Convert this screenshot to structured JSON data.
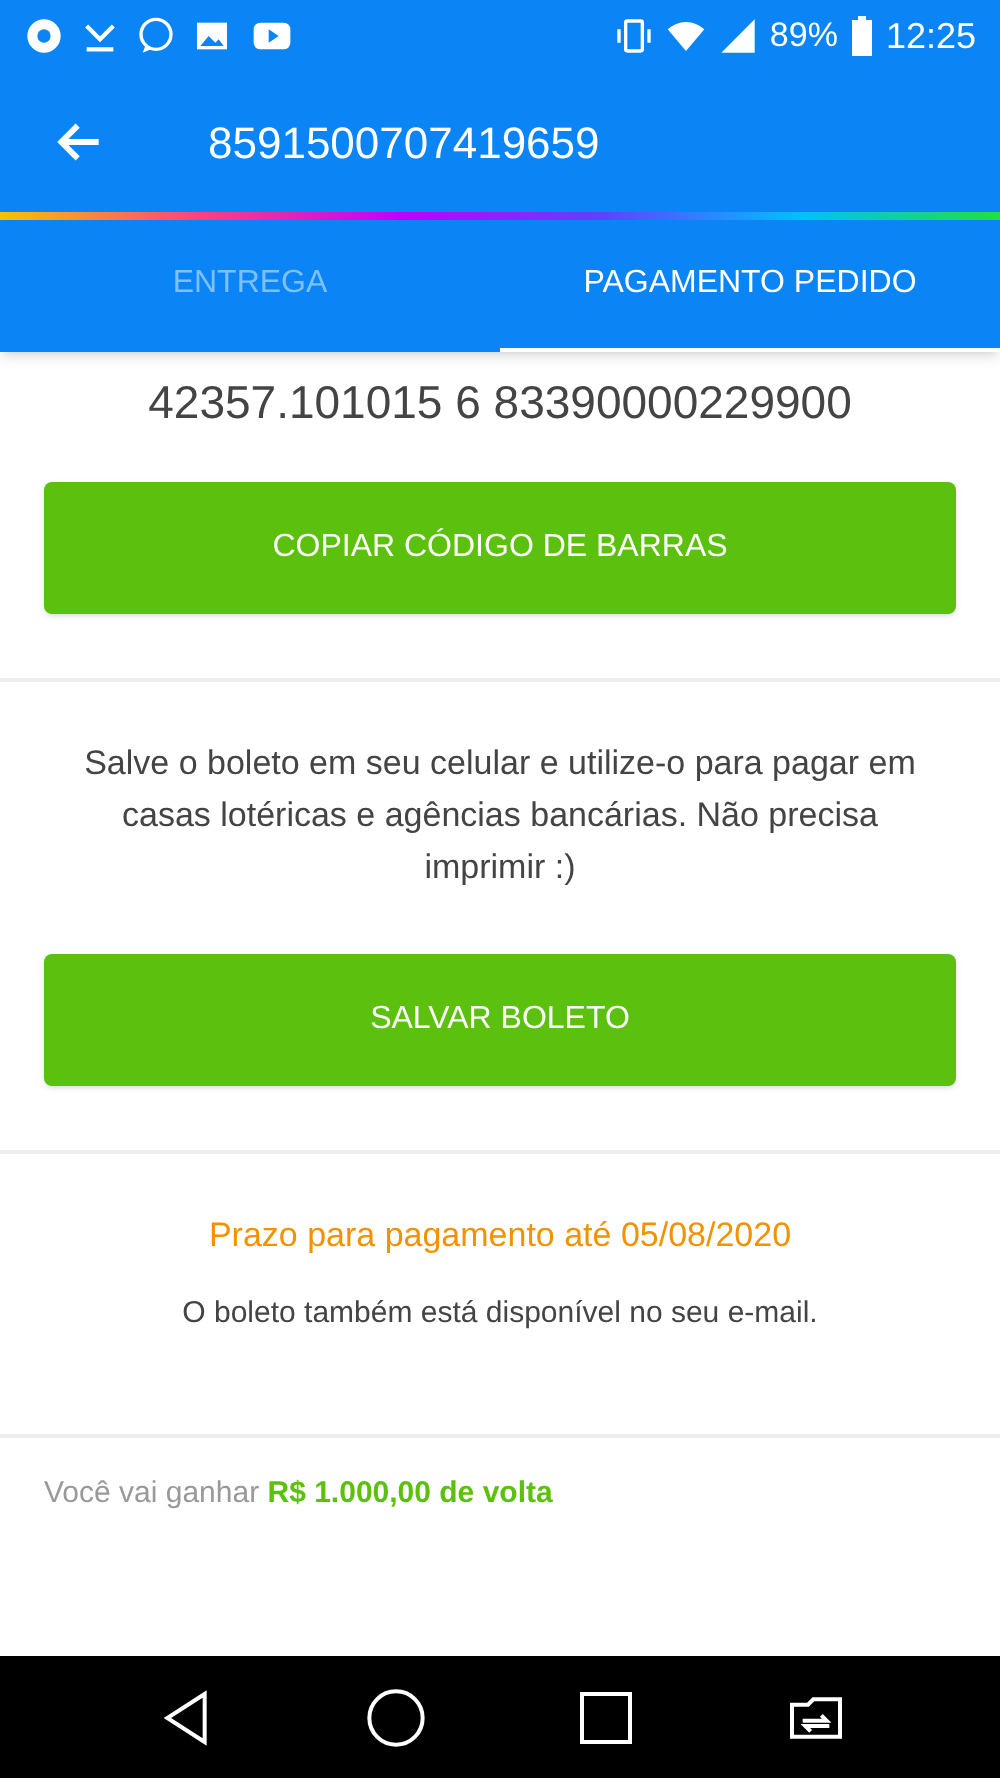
{
  "status_bar": {
    "battery": "89%",
    "time": "12:25"
  },
  "header": {
    "title": "8591500707419659"
  },
  "tabs": [
    {
      "label": "ENTREGA",
      "selected": false
    },
    {
      "label": "PAGAMENTO PEDIDO",
      "selected": true
    }
  ],
  "barcode": {
    "line": "42357.101015 6 83390000229900",
    "button": "COPIAR CÓDIGO DE BARRAS"
  },
  "save": {
    "text": "Salve o boleto em seu celular e utilize-o para pagar em casas lotéricas e agências bancárias. Não precisa imprimir :)",
    "button": "SALVAR BOLETO"
  },
  "deadline": {
    "due": "Prazo para pagamento até 05/08/2020",
    "note": "O boleto também está disponível no seu e-mail."
  },
  "cashback": "Você vai ganhar **R$ 1.000,00 de volta**"
}
